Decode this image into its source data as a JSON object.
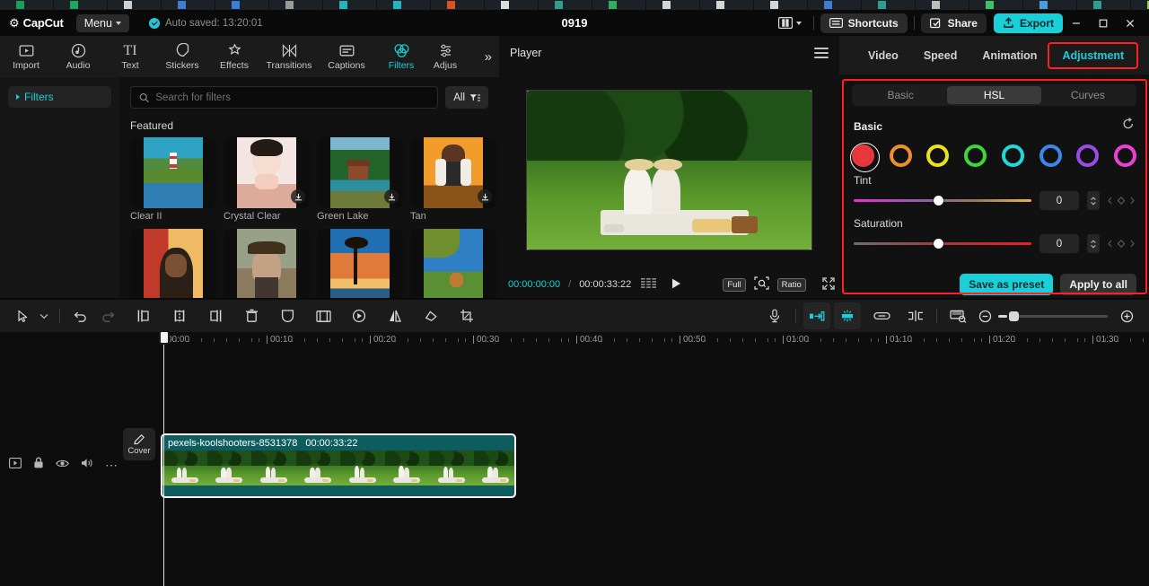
{
  "titlebar": {
    "app_name": "CapCut",
    "menu_label": "Menu",
    "autosave_text": "Auto saved: 13:20:01",
    "project_title": "0919",
    "shortcuts_label": "Shortcuts",
    "share_label": "Share",
    "export_label": "Export",
    "accent": "#19cfd8"
  },
  "toolnav": {
    "items": [
      {
        "label": "Import",
        "icon": "import-icon",
        "active": false
      },
      {
        "label": "Audio",
        "icon": "audio-icon",
        "active": false
      },
      {
        "label": "Text",
        "icon": "text-icon",
        "active": false
      },
      {
        "label": "Stickers",
        "icon": "stickers-icon",
        "active": false
      },
      {
        "label": "Effects",
        "icon": "effects-icon",
        "active": false
      },
      {
        "label": "Transitions",
        "icon": "transitions-icon",
        "active": false
      },
      {
        "label": "Captions",
        "icon": "captions-icon",
        "active": false
      },
      {
        "label": "Filters",
        "icon": "filters-icon",
        "active": true
      },
      {
        "label": "Adjus",
        "icon": "adjustment-icon",
        "active": false
      }
    ],
    "more_label": "»"
  },
  "library": {
    "side_item": "Filters",
    "search_placeholder": "Search for filters",
    "search_value": "",
    "filter_all_label": "All",
    "section_title": "Featured",
    "items": [
      {
        "name": "Clear II",
        "downloadable": false
      },
      {
        "name": "Crystal Clear",
        "downloadable": true
      },
      {
        "name": "Green Lake",
        "downloadable": true
      },
      {
        "name": "Tan",
        "downloadable": true
      },
      {
        "name": "",
        "downloadable": false
      },
      {
        "name": "",
        "downloadable": false
      },
      {
        "name": "",
        "downloadable": false
      },
      {
        "name": "",
        "downloadable": false
      }
    ]
  },
  "player": {
    "title": "Player",
    "current_time": "00:00:00:00",
    "separator": "/",
    "total_time": "00:00:33:22",
    "full_label": "Full",
    "ratio_label": "Ratio"
  },
  "inspector": {
    "tabs": [
      {
        "label": "Video",
        "active": false,
        "highlighted": false
      },
      {
        "label": "Speed",
        "active": false,
        "highlighted": false
      },
      {
        "label": "Animation",
        "active": false,
        "highlighted": false
      },
      {
        "label": "Adjustment",
        "active": true,
        "highlighted": true
      }
    ],
    "segments": [
      {
        "label": "Basic",
        "on": false
      },
      {
        "label": "HSL",
        "on": true
      },
      {
        "label": "Curves",
        "on": false
      }
    ],
    "section_title": "Basic",
    "reset_icon": "reset-icon",
    "swatches": [
      {
        "name": "red",
        "color": "#e8373d",
        "selected": true
      },
      {
        "name": "orange",
        "color": "#ef8f2a",
        "selected": false
      },
      {
        "name": "yellow",
        "color": "#ece316",
        "selected": false
      },
      {
        "name": "green",
        "color": "#3ed43a",
        "selected": false
      },
      {
        "name": "cyan",
        "color": "#23d6d9",
        "selected": false
      },
      {
        "name": "blue",
        "color": "#3c86ee",
        "selected": false
      },
      {
        "name": "purple",
        "color": "#9b4ae8",
        "selected": false
      },
      {
        "name": "magenta",
        "color": "#ec3fd6",
        "selected": false
      }
    ],
    "sliders": [
      {
        "label": "Tint",
        "value": "0",
        "pos_pct": 45,
        "gradient": "linear-gradient(90deg,#ee2bdc,#8d5fa8 40%,#9a7a56 70%,#edb04a)"
      },
      {
        "label": "Saturation",
        "value": "0",
        "pos_pct": 45,
        "gradient": "linear-gradient(90deg,#6e6e6e,#a03a3a 50%,#f01d1d)"
      }
    ],
    "save_preset_label": "Save as preset",
    "apply_all_label": "Apply to all",
    "highlight_color": "#ff2020"
  },
  "timeline_toolbar": {
    "left_tools": [
      {
        "name": "select-tool-icon"
      },
      {
        "name": "tool-dropdown-chevron-icon"
      },
      {
        "name": "undo-icon"
      },
      {
        "name": "redo-icon"
      },
      {
        "name": "split-left-icon"
      },
      {
        "name": "split-icon"
      },
      {
        "name": "split-right-icon"
      },
      {
        "name": "delete-icon"
      },
      {
        "name": "mask-icon"
      },
      {
        "name": "crop-frame-icon"
      },
      {
        "name": "freeze-frame-icon"
      },
      {
        "name": "mirror-icon"
      },
      {
        "name": "rotate-icon"
      },
      {
        "name": "crop-icon"
      }
    ],
    "right_tools": [
      {
        "name": "microphone-icon"
      },
      {
        "name": "auto-cut-icon"
      },
      {
        "name": "magnetic-icon"
      },
      {
        "name": "link-icon"
      },
      {
        "name": "snap-icon"
      },
      {
        "name": "preview-thumbnail-icon"
      },
      {
        "name": "zoom-out-icon"
      },
      {
        "name": "zoom-fit-icon"
      }
    ]
  },
  "timeline": {
    "ruler_labels": [
      "00:00",
      "00:10",
      "00:20",
      "00:30",
      "00:40",
      "00:50",
      "01:00",
      "01:10",
      "01:20",
      "01:30"
    ],
    "playhead_time": "00:00",
    "cover_label": "Cover",
    "track_head_icons": [
      "track-thumbnail-icon",
      "lock-icon",
      "eye-icon",
      "speaker-icon",
      "more-icon"
    ],
    "clip": {
      "name": "pexels-koolshooters-8531378",
      "duration": "00:00:33:22",
      "color": "#0d5d60"
    }
  }
}
